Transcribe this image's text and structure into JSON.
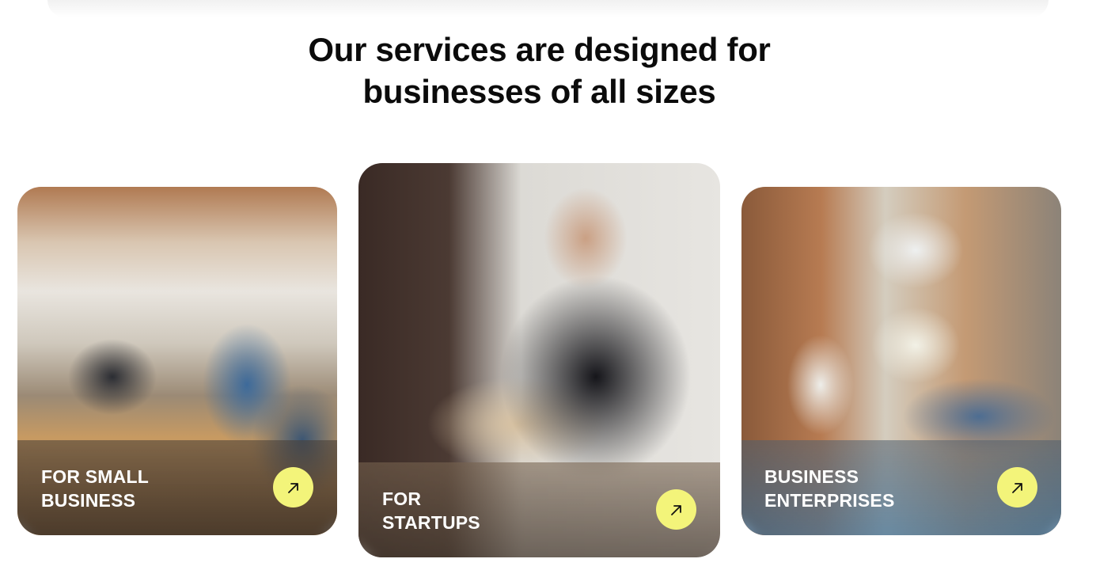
{
  "section": {
    "heading_line1": "Our services are designed for",
    "heading_line2": "businesses of all sizes"
  },
  "cards": [
    {
      "title_line1": "FOR SMALL",
      "title_line2": "BUSINESS",
      "image_alt": "Team working in an open office",
      "arrow_icon": "arrow-up-right-icon"
    },
    {
      "title_line1": "FOR",
      "title_line2": "STARTUPS",
      "image_alt": "Smiling man working on a laptop",
      "arrow_icon": "arrow-up-right-icon"
    },
    {
      "title_line1": "BUSINESS",
      "title_line2": "ENTERPRISES",
      "image_alt": "Team meeting with a whiteboard",
      "arrow_icon": "arrow-up-right-icon"
    }
  ],
  "colors": {
    "accent": "#f3f47a",
    "heading": "#0b0b0b",
    "card_label": "#ffffff"
  }
}
